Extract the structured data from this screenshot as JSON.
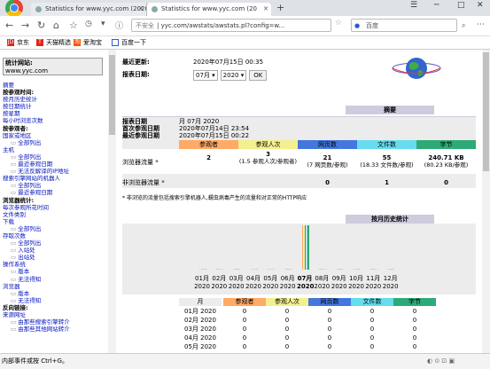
{
  "browser": {
    "tabs": [
      {
        "title": "Statistics for www.yyc.com (2020"
      },
      {
        "title": "Statistics for www.yyc.com (20"
      }
    ],
    "new_tab": "+",
    "window_buttons": [
      "–",
      "□",
      "✕"
    ],
    "minimize": "─",
    "address": {
      "security": "不安全",
      "url": "yyc.com/awstats/awstats.pl?config=w..."
    },
    "search_placeholder": "百度",
    "bookmarks": [
      {
        "label": "京东",
        "icon": "JD",
        "color": "#e1251b"
      },
      {
        "label": "天猫精选",
        "icon": "T",
        "color": "#e1251b"
      },
      {
        "label": "爱淘宝",
        "icon": "淘",
        "color": "#ff5000"
      },
      {
        "label": "百度一下",
        "icon": "",
        "color": "#2a5bd7"
      }
    ]
  },
  "sidebar": {
    "site_label": "统计网站:",
    "site_value": "www.yyc.com",
    "menu": [
      {
        "text": "摘要",
        "kind": "a"
      },
      {
        "text": "按参观时间:",
        "kind": "h"
      },
      {
        "text": "按月历史统计",
        "kind": "a"
      },
      {
        "text": "按日期统计",
        "kind": "a"
      },
      {
        "text": "按星期",
        "kind": "a"
      },
      {
        "text": "每小时浏览次数",
        "kind": "a"
      },
      {
        "text": "按参观者:",
        "kind": "h"
      },
      {
        "text": "国家或地区",
        "kind": "a"
      },
      {
        "text": "全部列出",
        "kind": "s"
      },
      {
        "text": "主机",
        "kind": "a"
      },
      {
        "text": "全部列出",
        "kind": "s"
      },
      {
        "text": "最近参观日期",
        "kind": "s"
      },
      {
        "text": "无法反解译的IP地址",
        "kind": "s"
      },
      {
        "text": "搜索引擎网站的机器人",
        "kind": "a"
      },
      {
        "text": "全部列出",
        "kind": "s"
      },
      {
        "text": "最近参观日期",
        "kind": "s"
      },
      {
        "text": "浏览器统计:",
        "kind": "h"
      },
      {
        "text": "每次参观所花时间",
        "kind": "a"
      },
      {
        "text": "文件类别",
        "kind": "a"
      },
      {
        "text": "下载",
        "kind": "a"
      },
      {
        "text": "全部列出",
        "kind": "s"
      },
      {
        "text": "存取次数",
        "kind": "a"
      },
      {
        "text": "全部列出",
        "kind": "s"
      },
      {
        "text": "入站处",
        "kind": "s"
      },
      {
        "text": "出站处",
        "kind": "s"
      },
      {
        "text": "操作系统",
        "kind": "a"
      },
      {
        "text": "版本",
        "kind": "s"
      },
      {
        "text": "无法得知",
        "kind": "s"
      },
      {
        "text": "浏览器",
        "kind": "a"
      },
      {
        "text": "版本",
        "kind": "s"
      },
      {
        "text": "无法得知",
        "kind": "s"
      },
      {
        "text": "反向链接:",
        "kind": "h"
      },
      {
        "text": "来源网址",
        "kind": "a"
      },
      {
        "text": "由那些搜索引擎转介",
        "kind": "s"
      },
      {
        "text": "由那些其他网站转介",
        "kind": "s"
      }
    ]
  },
  "main": {
    "last_update_label": "最近更新:",
    "last_update_value": "2020年07月15日 00:35",
    "report_date_label": "报表日期:",
    "month_select": "07月",
    "year_select": "2020",
    "ok_label": "OK",
    "summary_title": "摘要",
    "summary": {
      "report_label": "报表日期",
      "report_value": "月 07月 2020",
      "first_label": "首次参观日期",
      "first_value": "2020年07月14日 23:54",
      "last_label": "最近参观日期",
      "last_value": "2020年07月15日 00:22"
    },
    "columns": [
      {
        "label": "参观者",
        "color": "#ffaa66"
      },
      {
        "label": "参观人次",
        "color": "#f4f090"
      },
      {
        "label": "网页数",
        "color": "#4477dd"
      },
      {
        "label": "文件数",
        "color": "#66ddee"
      },
      {
        "label": "字节",
        "color": "#2eaa77"
      }
    ],
    "viewed_label": "浏览器流量 *",
    "viewed": {
      "visitors": "2",
      "visits": "3",
      "visits_sub": "(1.5 参观人次/参观者)",
      "pages": "21",
      "pages_sub": "(7 网页数/参观)",
      "files": "55",
      "files_sub": "(18.33 文件数/参观)",
      "bytes": "240.71 KB",
      "bytes_sub": "(80.23 KB/参观)"
    },
    "notviewed_label": "非浏览器流量 *",
    "notviewed": {
      "pages": "0",
      "files": "1",
      "bytes": "0"
    },
    "note": "* 非浏览的流量包括搜索引擎机器人,蠕虫病毒产生的流量和对正常的HTTP响应",
    "history_title": "按月历史统计",
    "months": [
      "01月",
      "02月",
      "03月",
      "04月",
      "05月",
      "06月",
      "07月",
      "08月",
      "09月",
      "10月",
      "11月",
      "12月"
    ],
    "year": "2020",
    "month_table_headers": [
      "月",
      "参观者",
      "参观人次",
      "网页数",
      "文件数",
      "字节"
    ],
    "month_rows": [
      {
        "month": "01月 2020",
        "v": [
          "0",
          "0",
          "0",
          "0",
          "0"
        ]
      },
      {
        "month": "02月 2020",
        "v": [
          "0",
          "0",
          "0",
          "0",
          "0"
        ]
      },
      {
        "month": "03月 2020",
        "v": [
          "0",
          "0",
          "0",
          "0",
          "0"
        ]
      },
      {
        "month": "04月 2020",
        "v": [
          "0",
          "0",
          "0",
          "0",
          "0"
        ]
      },
      {
        "month": "05月 2020",
        "v": [
          "0",
          "0",
          "0",
          "0",
          "0"
        ]
      }
    ]
  },
  "chart_data": {
    "type": "bar",
    "categories": [
      "01月",
      "02月",
      "03月",
      "04月",
      "05月",
      "06月",
      "07月",
      "08月",
      "09月",
      "10月",
      "11月",
      "12月"
    ],
    "series": [
      {
        "name": "参观者",
        "color": "#ffaa66",
        "values": [
          0,
          0,
          0,
          0,
          0,
          0,
          2,
          0,
          0,
          0,
          0,
          0
        ]
      },
      {
        "name": "参观人次",
        "color": "#f4f090",
        "values": [
          0,
          0,
          0,
          0,
          0,
          0,
          3,
          0,
          0,
          0,
          0,
          0
        ]
      },
      {
        "name": "网页数",
        "color": "#4477dd",
        "values": [
          0,
          0,
          0,
          0,
          0,
          0,
          21,
          0,
          0,
          0,
          0,
          0
        ]
      },
      {
        "name": "文件数",
        "color": "#66ddee",
        "values": [
          0,
          0,
          0,
          0,
          0,
          0,
          55,
          0,
          0,
          0,
          0,
          0
        ]
      },
      {
        "name": "字节",
        "color": "#2eaa77",
        "values": [
          0,
          0,
          0,
          0,
          0,
          0,
          240.71,
          0,
          0,
          0,
          0,
          0
        ]
      }
    ]
  },
  "status": {
    "text": "内部事件或按 Ctrl+G。"
  }
}
